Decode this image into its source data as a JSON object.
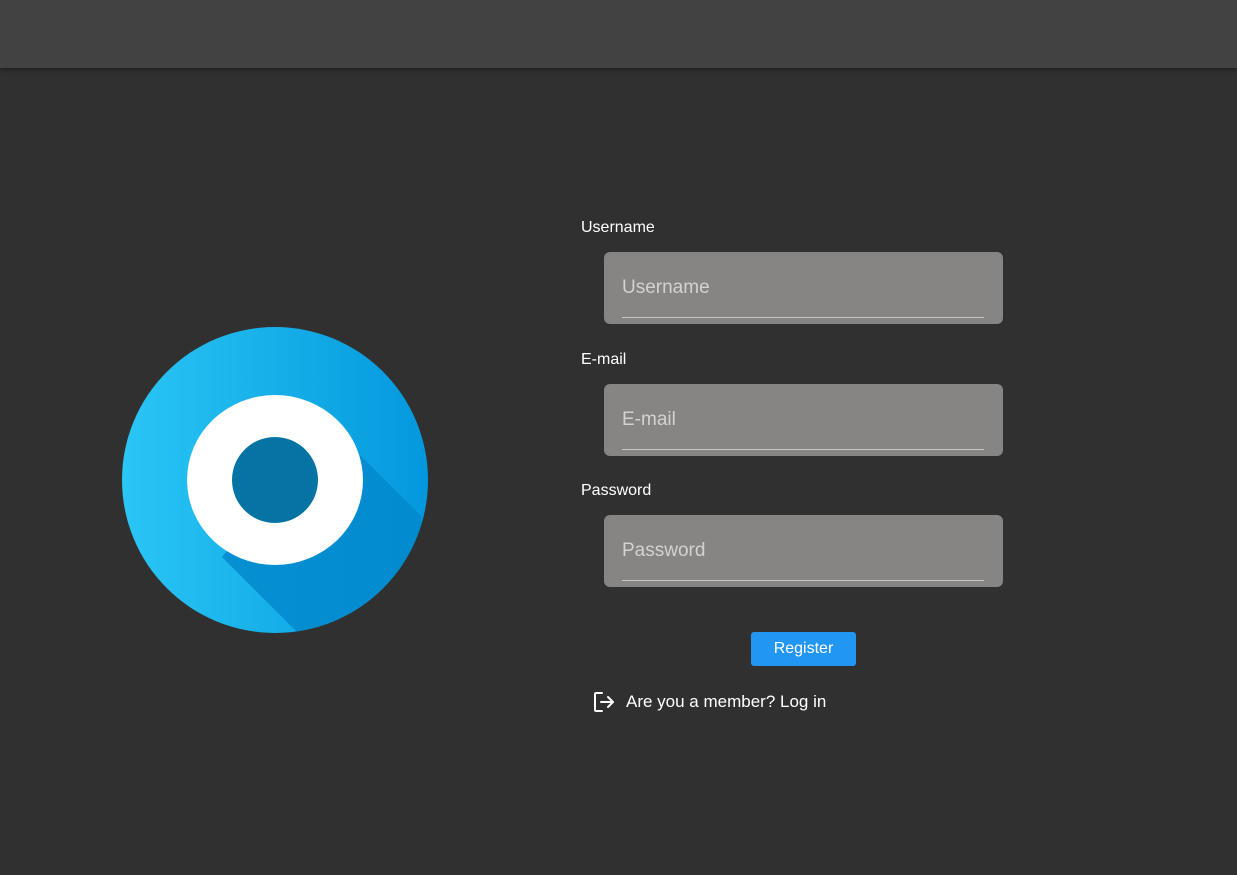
{
  "form": {
    "username": {
      "label": "Username",
      "placeholder": "Username",
      "value": ""
    },
    "email": {
      "label": "E-mail",
      "placeholder": "E-mail",
      "value": ""
    },
    "password": {
      "label": "Password",
      "placeholder": "Password",
      "value": ""
    },
    "register_label": "Register",
    "login_prompt": "Are you a member? Log in"
  },
  "icons": {
    "logo": "app-logo",
    "login": "login-icon"
  },
  "colors": {
    "background": "#303030",
    "topbar": "#424242",
    "field": "#878583",
    "accent": "#2196f3",
    "logo_light": "#29c1f0",
    "logo_dark": "#0288d1"
  }
}
